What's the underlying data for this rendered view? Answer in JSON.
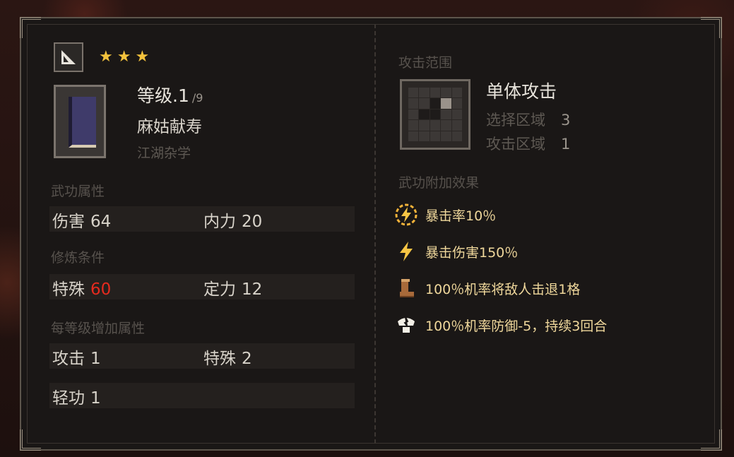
{
  "skill": {
    "stars": "★★★",
    "level_label": "等级.1",
    "level_max": "/9",
    "name": "麻姑献寿",
    "category": "江湖杂学"
  },
  "attributes": {
    "title": "武功属性",
    "damage_label": "伤害",
    "damage_value": "64",
    "inner_label": "内力",
    "inner_value": "20"
  },
  "requirements": {
    "title": "修炼条件",
    "special_label": "特殊",
    "special_value": "60",
    "focus_label": "定力",
    "focus_value": "12"
  },
  "per_level": {
    "title": "每等级增加属性",
    "attack_label": "攻击",
    "attack_value": "1",
    "special_label": "特殊",
    "special_value": "2",
    "agility_label": "轻功",
    "agility_value": "1"
  },
  "range": {
    "title": "攻击范围",
    "type": "单体攻击",
    "select_label": "选择区域",
    "select_value": "3",
    "attack_label": "攻击区域",
    "attack_value": "1"
  },
  "effects": {
    "title": "武功附加效果",
    "items": [
      {
        "icon": "lightning-circle-icon",
        "text": "暴击率10％"
      },
      {
        "icon": "lightning-icon",
        "text": "暴击伤害150％"
      },
      {
        "icon": "boot-icon",
        "text": "100％机率将敌人击退1格"
      },
      {
        "icon": "broken-shield-icon",
        "text": "100％机率防御-5，持续3回合"
      }
    ]
  },
  "colors": {
    "highlight_red": "#e52a1e",
    "effect_text": "#efd79b",
    "star": "#f3c23c"
  }
}
